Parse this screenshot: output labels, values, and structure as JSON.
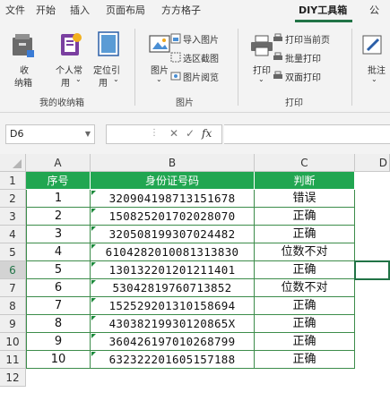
{
  "menu": {
    "items": [
      "文件",
      "开始",
      "插入",
      "页面布局",
      "方方格子",
      "DIY工具箱",
      "公"
    ],
    "active": "DIY工具箱"
  },
  "ribbon": {
    "group1": {
      "btn_collect_l1": "收",
      "btn_collect_l2": "纳箱",
      "btn_personal_l1": "个人常",
      "btn_personal_l2": "用",
      "btn_custom_l1": "定位引",
      "btn_custom_l2": "用",
      "label": "我的收纳箱"
    },
    "group2": {
      "btn_image_l1": "图片",
      "btn_import": "导入图片",
      "btn_select_shot": "选区截图",
      "btn_browse": "图片阅览",
      "label": "图片"
    },
    "group3": {
      "btn_print": "打印",
      "btn_print_current": "打印当前页",
      "btn_batch_print": "批量打印",
      "btn_duplex": "双面打印",
      "label": "打印"
    },
    "group4": {
      "btn_annotate": "批注"
    }
  },
  "formula": {
    "cell_ref": "D6",
    "fx": "fx",
    "value": ""
  },
  "sheet": {
    "columns": [
      "A",
      "B",
      "C",
      "D"
    ],
    "rows": [
      "1",
      "2",
      "3",
      "4",
      "5",
      "6",
      "7",
      "8",
      "9",
      "10",
      "11",
      "12"
    ],
    "header": [
      "序号",
      "身份证号码",
      "判断"
    ],
    "data": [
      [
        "1",
        "320904198713151678",
        "错误"
      ],
      [
        "2",
        "150825201702028070",
        "正确"
      ],
      [
        "3",
        "320508199307024482",
        "正确"
      ],
      [
        "4",
        "6104282010081313830",
        "位数不对"
      ],
      [
        "5",
        "130132201201211401",
        "正确"
      ],
      [
        "6",
        "53042819760713852",
        "位数不对"
      ],
      [
        "7",
        "152529201310158694",
        "正确"
      ],
      [
        "8",
        "43038219930120865X",
        "正确"
      ],
      [
        "9",
        "360426197010268799",
        "正确"
      ],
      [
        "10",
        "632322201605157188",
        "正确"
      ]
    ],
    "selected_cell": "D6",
    "colors": {
      "header_fill": "#21a651",
      "border": "#3c8c4a",
      "accent": "#217346"
    }
  }
}
